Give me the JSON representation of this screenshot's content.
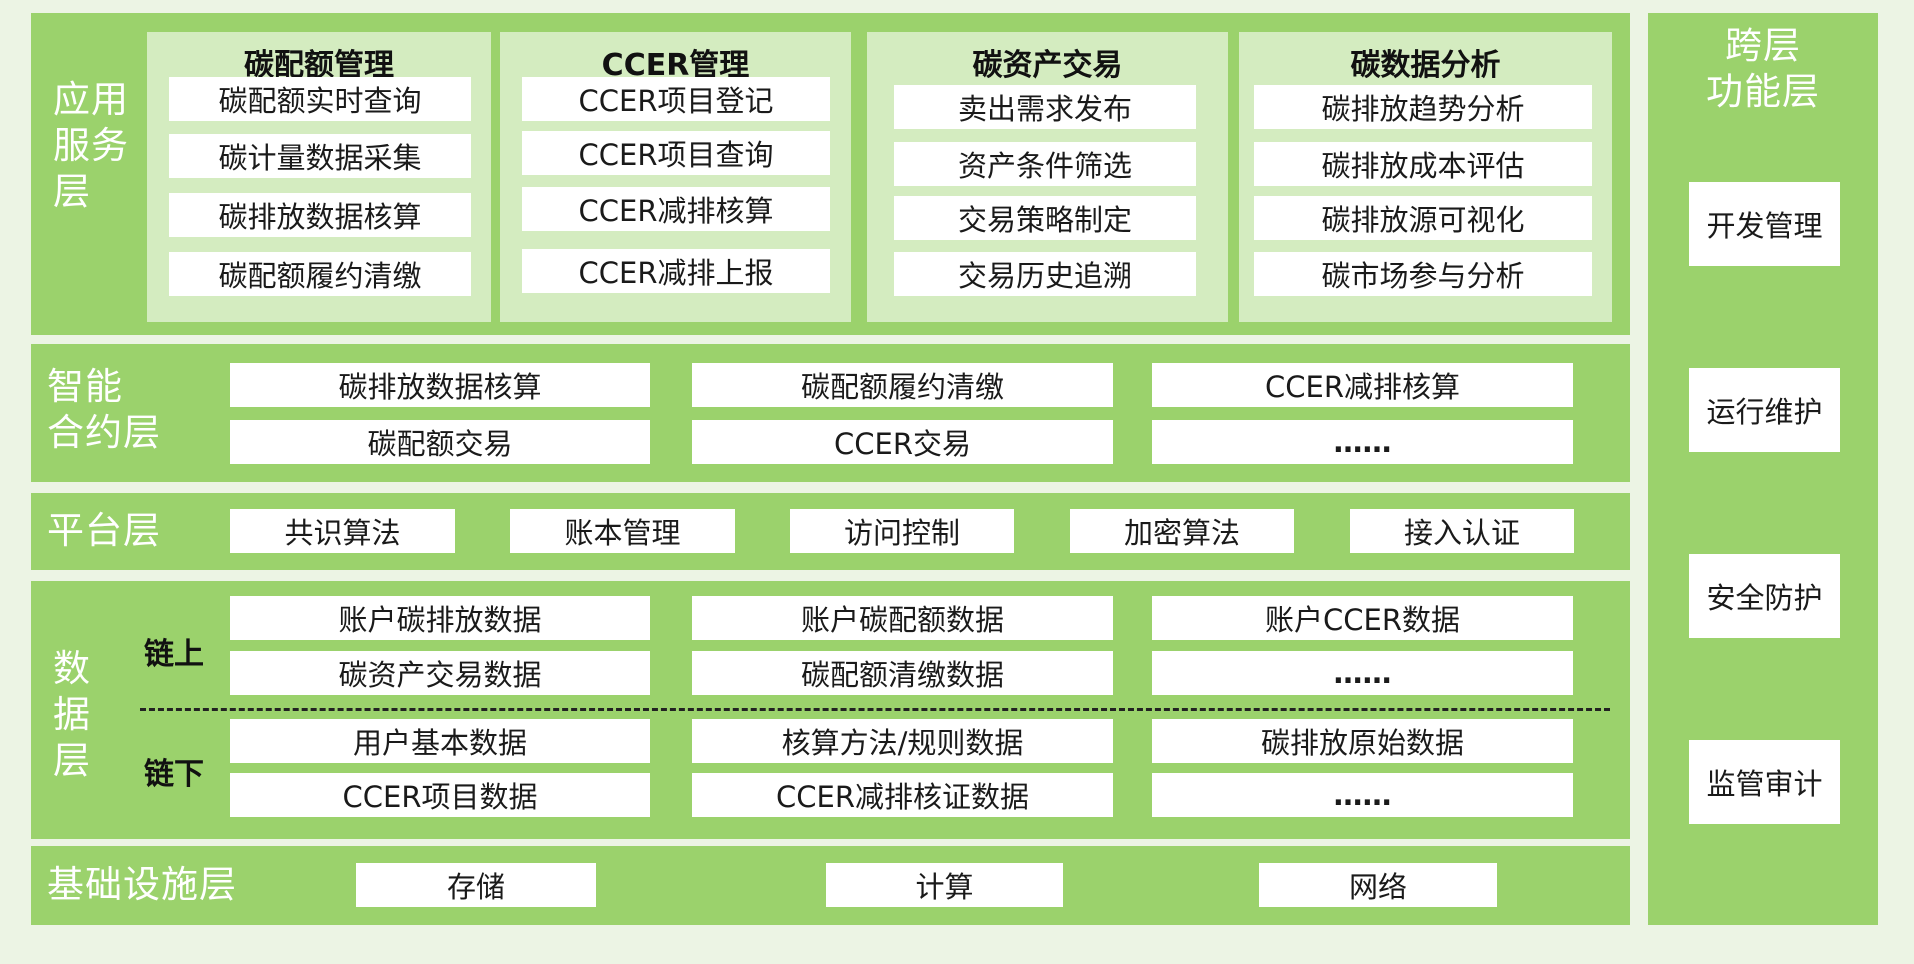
{
  "app": {
    "title": "",
    "layers": [
      {
        "name": "应用\n服务\n层",
        "panels": [
          {
            "title": "碳配额管理",
            "items": [
              "碳配额实时查询",
              "碳计量数据采集",
              "碳排放数据核算",
              "碳配额履约清缴"
            ]
          },
          {
            "title": "CCER管理",
            "items": [
              "CCER项目登记",
              "CCER项目查询",
              "CCER减排核算",
              "CCER减排上报"
            ]
          },
          {
            "title": "碳资产交易",
            "items": [
              "卖出需求发布",
              "资产条件筛选",
              "交易策略制定",
              "交易历史追溯"
            ]
          },
          {
            "title": "碳数据分析",
            "items": [
              "碳排放趋势分析",
              "碳排放成本评估",
              "碳排放源可视化",
              "碳市场参与分析"
            ]
          }
        ]
      },
      {
        "name": "智能\n合约层",
        "rows": [
          [
            "碳排放数据核算",
            "碳配额履约清缴",
            "CCER减排核算"
          ],
          [
            "碳配额交易",
            "CCER交易",
            "……"
          ]
        ]
      },
      {
        "name": "平台层",
        "items": [
          "共识算法",
          "账本管理",
          "访问控制",
          "加密算法",
          "接入认证"
        ]
      },
      {
        "name": "数\n据\n层",
        "on_chain": {
          "label": "链上",
          "rows": [
            [
              "账户碳排放数据",
              "账户碳配额数据",
              "账户CCER数据"
            ],
            [
              "碳资产交易数据",
              "碳配额清缴数据",
              "……"
            ]
          ]
        },
        "off_chain": {
          "label": "链下",
          "rows": [
            [
              "用户基本数据",
              "核算方法/规则数据",
              "碳排放原始数据"
            ],
            [
              "CCER项目数据",
              "CCER减排核证数据",
              "……"
            ]
          ]
        }
      },
      {
        "name": "基础设施层",
        "items": [
          "存储",
          "计算",
          "网络"
        ]
      }
    ],
    "cross_layer": {
      "title": "跨层\n功能层",
      "items": [
        "开发管理",
        "运行维护",
        "安全防护",
        "监管审计"
      ]
    }
  }
}
